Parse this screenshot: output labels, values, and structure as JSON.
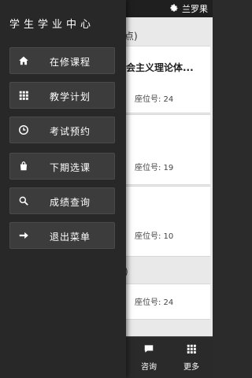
{
  "header": {
    "user_name": "兰罗果"
  },
  "list": {
    "group1_title": "考点)",
    "group2_title": "数)",
    "cards": [
      {
        "title": "会主义理论体...",
        "seat": "座位号: 24"
      },
      {
        "title": "",
        "seat": "座位号: 19"
      },
      {
        "title": "",
        "seat": "座位号: 10"
      },
      {
        "title": "",
        "seat": "座位号: 24"
      }
    ]
  },
  "bottom_nav": {
    "consult_label": "咨询",
    "more_label": "更多"
  },
  "drawer": {
    "title": "学生学业中心",
    "items": [
      {
        "label": "在修课程",
        "icon": "home-icon"
      },
      {
        "label": "教学计划",
        "icon": "grid-icon"
      },
      {
        "label": "考试预约",
        "icon": "clock-icon"
      },
      {
        "label": "下期选课",
        "icon": "bag-icon"
      },
      {
        "label": "成绩查询",
        "icon": "search-icon"
      },
      {
        "label": "退出菜单",
        "icon": "arrow-right-icon"
      }
    ]
  },
  "colors": {
    "drawer_bg": "#282828",
    "menu_item_bg": "#3c3c3c",
    "page_bg": "#e9e9e9",
    "card_bg": "#ffffff"
  }
}
